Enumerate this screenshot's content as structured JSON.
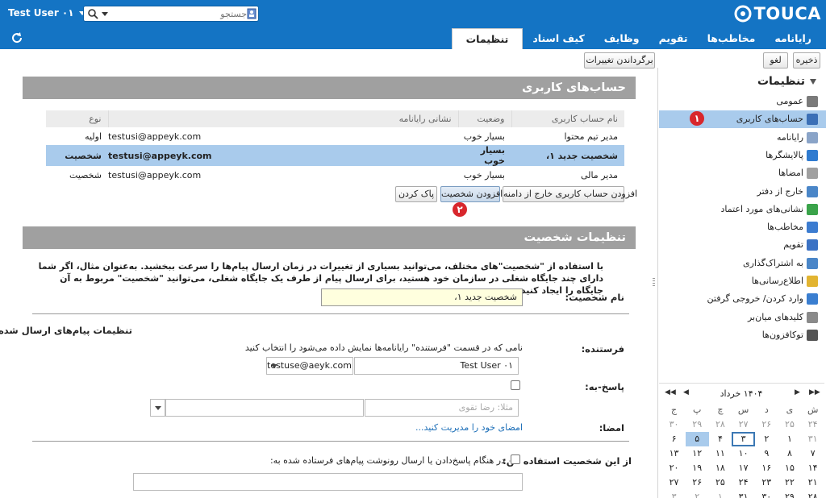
{
  "topbar": {
    "user_name": "Test User ۰۱",
    "search_placeholder": "جستجو",
    "logo_text": "TOUCA"
  },
  "nav": {
    "tabs": [
      "رایانامه",
      "مخاطب‌ها",
      "تقویم",
      "وظایف",
      "کیف اسناد",
      "تنظیمات"
    ],
    "active_tab": "تنظیمات"
  },
  "toolbar": {
    "save_label": "ذخیره",
    "cancel_label": "لغو",
    "revert_label": "برگرداندن تغییرات"
  },
  "sidebar": {
    "title": "تنظیمات",
    "items": [
      {
        "label": "عمومی",
        "icon": "gear-icon",
        "color": "#7a7a7a"
      },
      {
        "label": "حساب‌های کاربری",
        "icon": "account-icon",
        "color": "#3b6fb6"
      },
      {
        "label": "رایانامه",
        "icon": "envelope-icon",
        "color": "#8aa4c8"
      },
      {
        "label": "پالایشگرها",
        "icon": "filter-icon",
        "color": "#2f7bd0"
      },
      {
        "label": "امضاها",
        "icon": "signature-icon",
        "color": "#a0a0a0"
      },
      {
        "label": "خارج از دفتر",
        "icon": "clock-icon",
        "color": "#4a86c8"
      },
      {
        "label": "نشانی‌های مورد اعتماد",
        "icon": "shield-icon",
        "color": "#3aa34a"
      },
      {
        "label": "مخاطب‌ها",
        "icon": "contact-icon",
        "color": "#3c7cd0"
      },
      {
        "label": "تقویم",
        "icon": "calendar-icon",
        "color": "#3b72c4"
      },
      {
        "label": "به اشتراک‌گذاری",
        "icon": "share-icon",
        "color": "#4a86c8"
      },
      {
        "label": "اطلاع‌رسانی‌ها",
        "icon": "bell-icon",
        "color": "#e2b431"
      },
      {
        "label": "وارد کردن/ خروجی گرفتن",
        "icon": "import-export-icon",
        "color": "#3a7ed0"
      },
      {
        "label": "کلیدهای میان‌بر",
        "icon": "keyboard-icon",
        "color": "#8a8a8a"
      },
      {
        "label": "توکافزون‌ها",
        "icon": "zimlet-icon",
        "color": "#555555"
      }
    ],
    "selected_badge": "۱"
  },
  "calendar": {
    "month_label": "۱۴۰۴ خرداد",
    "weekdays": [
      "ش",
      "ی",
      "د",
      "س",
      "چ",
      "پ",
      "ج"
    ],
    "weeks": [
      [
        "۲۴",
        "۲۵",
        "۲۶",
        "۲۷",
        "۲۸",
        "۲۹",
        "۳۰"
      ],
      [
        "۳۱",
        "۱",
        "۲",
        "۳",
        "۴",
        "۵",
        "۶"
      ],
      [
        "۷",
        "۸",
        "۹",
        "۱۰",
        "۱۱",
        "۱۲",
        "۱۳"
      ],
      [
        "۱۴",
        "۱۵",
        "۱۶",
        "۱۷",
        "۱۸",
        "۱۹",
        "۲۰"
      ],
      [
        "۲۱",
        "۲۲",
        "۲۳",
        "۲۴",
        "۲۵",
        "۲۶",
        "۲۷"
      ],
      [
        "۲۸",
        "۲۹",
        "۳۰",
        "۳۱",
        "۱",
        "۲",
        "۳"
      ]
    ],
    "nav_prev_year": "◀◀",
    "nav_prev": "◀",
    "nav_next": "▶",
    "nav_next_year": "▶▶"
  },
  "accounts_section": {
    "title": "حساب‌های کاربری",
    "columns": [
      "نام حساب کاربری",
      "وضعیت",
      "نشانی رایانامه",
      "نوع"
    ],
    "rows": [
      {
        "name": "مدیر تیم محتوا",
        "status": "بسیار خوب",
        "email": "testusi@appeyk.com",
        "type": "اولیه"
      },
      {
        "name": "شخصیت جدید ۱،",
        "status": "بسیار خوب",
        "email": "testusi@appeyk.com",
        "type": "شخصیت"
      },
      {
        "name": "مدیر مالی",
        "status": "بسیار خوب",
        "email": "testusi@appeyk.com",
        "type": "شخصیت"
      }
    ],
    "selected_row": 1,
    "btn_add_external": "افزودن حساب کاربری خارج از دامنه",
    "btn_add_persona": "افزودن شخصیت",
    "btn_delete": "پاک کردن",
    "badge": "۲"
  },
  "persona_section": {
    "title": "تنظیمات شخصیت",
    "description": "با استفاده از \"شخصیت\"های مختلف، می‌توانید بسیاری از تغییرات در زمان ارسال پیام‌ها را سرعت ببخشید. به‌عنوان مثال، اگر شما دارای چند جایگاه شغلی در سازمان خود هستید، برای ارسال پیام از طرف یک جایگاه شغلی، می‌توانید \"شخصیت\" مربوط به آن جایگاه را ایجاد کنید.",
    "name_label": "نام شخصیت:",
    "name_value": "شخصیت جدید ۱،",
    "sent_settings_title": "تنظیمات پیام‌های ارسال شده",
    "from_label": "فرستنده:",
    "from_hint": "نامی که در قسمت \"فرستنده\" رایانامه‌ها نمایش داده می‌شود را انتخاب کنید",
    "from_name_value": "Test User ۰۱",
    "from_email_value": "testuse@aeyk.com",
    "reply_to_label": "پاسخ-به:",
    "reply_to_placeholder": "مثلا: رضا تقوی",
    "signature_label": "امضا:",
    "signature_link": "امضای خود را مدیریت کنید...",
    "use_persona_label": "از این شخصیت استفاده کن:",
    "use_persona_option": "در هنگام پاسخ‌دادن یا ارسال رونوشت پیام‌های فرستاده شده به:"
  }
}
